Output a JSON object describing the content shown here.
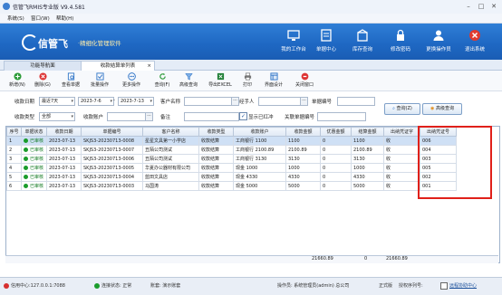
{
  "window": {
    "title": "信管飞RMIS专业版 V9.4.581"
  },
  "menu": [
    "系统(S)",
    "窗口(W)",
    "帮助(H)"
  ],
  "banner": {
    "logo": "信管飞",
    "slogan": "·精细化管理软件",
    "nav": [
      {
        "label": "我的工作台",
        "icon": "monitor-icon"
      },
      {
        "label": "单据中心",
        "icon": "document-icon"
      },
      {
        "label": "库存查询",
        "icon": "box-icon"
      },
      {
        "label": "修改密码",
        "icon": "lock-icon"
      },
      {
        "label": "更换操作员",
        "icon": "user-icon"
      },
      {
        "label": "退出系统",
        "icon": "close-icon"
      }
    ]
  },
  "tabs": [
    {
      "label": "功能导航面"
    },
    {
      "label": "收款结算单列表",
      "close": "×"
    }
  ],
  "toolbar": [
    {
      "label": "新增(N)",
      "icon": "add-icon",
      "color": "#2e9b3a"
    },
    {
      "label": "删除(G)",
      "icon": "delete-icon",
      "color": "#d33"
    },
    {
      "label": "查看单据",
      "icon": "view-icon",
      "color": "#2f74c7"
    },
    {
      "label": "批量操作",
      "icon": "batch-icon",
      "color": "#2f74c7"
    },
    {
      "label": "更多操作",
      "icon": "more-icon",
      "color": "#2f74c7"
    },
    {
      "label": "查询(F)",
      "icon": "refresh-icon",
      "color": "#2e9b3a"
    },
    {
      "label": "高级查询",
      "icon": "filter-icon",
      "color": "#2f74c7"
    },
    {
      "label": "导出EXCEL",
      "icon": "excel-icon",
      "color": "#1e7e34"
    },
    {
      "label": "打印",
      "icon": "print-icon",
      "color": "#555"
    },
    {
      "label": "界面设计",
      "icon": "design-icon",
      "color": "#2f74c7"
    },
    {
      "label": "关闭窗口",
      "icon": "exit-icon",
      "color": "#d33"
    }
  ],
  "filter": {
    "date_label": "收款日期",
    "date_range": "最近7天",
    "date_from": "2023-7-6",
    "to_label": "-",
    "date_to": "2023-7-13",
    "customer_label": "客户名称",
    "customer_value": "",
    "handler_label": "经手人",
    "handler_value": "",
    "doc_no_label": "单据编号",
    "doc_no_value": "",
    "type_label": "收款类型",
    "type_value": "全部",
    "account_label": "收款账户",
    "account_value": "",
    "remark_label": "备注",
    "remark_value": "",
    "show_offset_label": "显示已红冲",
    "show_offset_checked": true,
    "related_label": "关联单据编号",
    "related_value": "",
    "query_button": "查询(Z)",
    "advanced_button": "高级查询"
  },
  "grid": {
    "columns": [
      "序号",
      "单据状态",
      "收款日期",
      "单据编号",
      "客户名称",
      "收款类型",
      "收款账户",
      "收款金额",
      "优惠金额",
      "结算金额",
      "出纳凭证字",
      "出纳凭证号"
    ],
    "rows": [
      [
        "1",
        "已审核",
        "2023-07-13",
        "SKJS3-20230713-0008",
        "星星文具第一小学店",
        "收款结算",
        "工商银行 1100",
        "1100",
        "0",
        "1100",
        "收",
        "006"
      ],
      [
        "2",
        "已审核",
        "2023-07-13",
        "SKJS3-20230713-0007",
        "丑陌公司测试",
        "收款结算",
        "工商银行 2100.89",
        "2100.89",
        "0",
        "2100.89",
        "收",
        "004"
      ],
      [
        "3",
        "已审核",
        "2023-07-13",
        "SKJS3-20230713-0006",
        "丑陌公司测试",
        "收款结算",
        "工商银行 3130",
        "3130",
        "0",
        "3130",
        "收",
        "003"
      ],
      [
        "4",
        "已审核",
        "2023-07-13",
        "SKJS3-20230713-0005",
        "华夏办公器材有限公司",
        "收款结算",
        "现金 1000",
        "1000",
        "0",
        "1000",
        "收",
        "005"
      ],
      [
        "5",
        "已审核",
        "2023-07-13",
        "SKJS3-20230713-0004",
        "蓝田文具店",
        "收款结算",
        "现金 4330",
        "4330",
        "0",
        "4330",
        "收",
        "002"
      ],
      [
        "6",
        "已审核",
        "2023-07-13",
        "SKJS3-20230713-0003",
        "马国涛",
        "收款结算",
        "现金 5000",
        "5000",
        "0",
        "5000",
        "收",
        "001"
      ]
    ],
    "selected_row": 1,
    "totals": {
      "receipt": "21660.89",
      "discount": "0",
      "settled": "21660.89"
    }
  },
  "statusbar": {
    "center": "信用中心:127.0.0.1:7088",
    "connection": "连接状态: 正常",
    "account_set": "账套: 演示账套",
    "operator": "操作员: 系统管理员(admin) 总公司",
    "version": "正式版",
    "license": "授权序列号:",
    "help": "远程协助中心"
  }
}
